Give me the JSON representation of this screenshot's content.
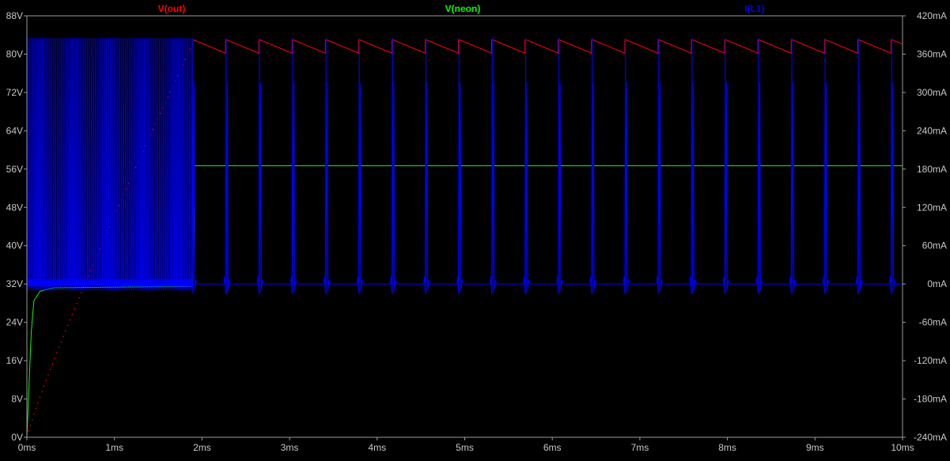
{
  "window": {
    "title": ""
  },
  "chart_data": {
    "type": "line",
    "title": "",
    "legend": {
      "placement": "top"
    },
    "grid": false,
    "x": {
      "label": "",
      "unit": "ms",
      "range": [
        0,
        10
      ],
      "ticks": [
        0,
        1,
        2,
        3,
        4,
        5,
        6,
        7,
        8,
        9,
        10
      ],
      "tick_labels": [
        "0ms",
        "1ms",
        "2ms",
        "3ms",
        "4ms",
        "5ms",
        "6ms",
        "7ms",
        "8ms",
        "9ms",
        "10ms"
      ]
    },
    "y_left": {
      "label": "",
      "unit": "V",
      "range": [
        0,
        88
      ],
      "ticks": [
        0,
        8,
        16,
        24,
        32,
        40,
        48,
        56,
        64,
        72,
        80,
        88
      ],
      "tick_labels": [
        "0V",
        "8V",
        "16V",
        "24V",
        "32V",
        "40V",
        "48V",
        "56V",
        "64V",
        "72V",
        "80V",
        "88V"
      ]
    },
    "y_right": {
      "label": "",
      "unit": "mA",
      "range": [
        -240,
        420
      ],
      "ticks": [
        -240,
        -180,
        -120,
        -60,
        0,
        60,
        120,
        180,
        240,
        300,
        360,
        420
      ],
      "tick_labels": [
        "-240mA",
        "-180mA",
        "-120mA",
        "-60mA",
        "0mA",
        "60mA",
        "120mA",
        "180mA",
        "240mA",
        "300mA",
        "360mA",
        "420mA"
      ]
    },
    "series": [
      {
        "name": "V(out)",
        "color": "#ff0000",
        "axis": "left",
        "charge_phase": {
          "t_start": 0.0,
          "t_end": 1.9,
          "v_start": 0,
          "v_end": 82.5
        },
        "sawtooth": {
          "period": 0.38,
          "v_high": 83.0,
          "v_low": 80.2,
          "t_start": 1.9,
          "t_end": 10.0
        }
      },
      {
        "name": "V(neon)",
        "color": "#00ff00",
        "axis": "left",
        "points": [
          [
            0.0,
            0.0
          ],
          [
            0.02,
            9.0
          ],
          [
            0.05,
            22.0
          ],
          [
            0.08,
            28.5
          ],
          [
            0.15,
            30.5
          ],
          [
            0.3,
            31.2
          ],
          [
            1.9,
            31.5
          ],
          [
            1.91,
            56.7
          ],
          [
            10.0,
            56.7
          ]
        ]
      },
      {
        "name": "I(L1)",
        "color": "#0000ff",
        "axis": "right",
        "baseline": 0,
        "dense_phase": {
          "t_start": 0.0,
          "t_end": 1.9,
          "pulses": 88,
          "peak": 385,
          "trough": -10
        },
        "pulse_phase": {
          "t_start": 1.9,
          "t_end": 10.0,
          "period": 0.38,
          "peak": 385,
          "trough": -15
        }
      }
    ]
  }
}
